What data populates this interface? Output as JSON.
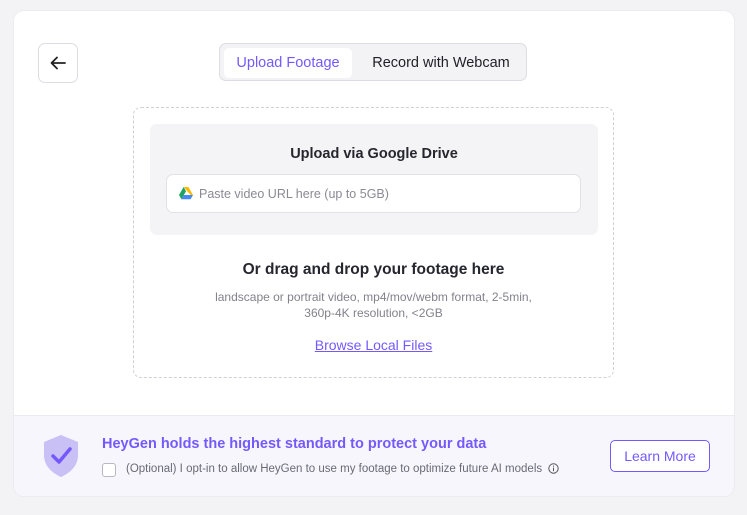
{
  "tabs": [
    {
      "label": "Upload Footage",
      "active": true
    },
    {
      "label": "Record with Webcam",
      "active": false
    }
  ],
  "back_button": {
    "icon": "arrow-left-icon"
  },
  "google_drive": {
    "title": "Upload via Google Drive",
    "placeholder": "Paste video URL here (up to 5GB)",
    "value": "",
    "icon": "google-drive-icon"
  },
  "drop_zone": {
    "title": "Or drag and drop your footage here",
    "description_line1": "landscape or portrait video, mp4/mov/webm format, 2-5min,",
    "description_line2": "360p-4K resolution, <2GB",
    "browse_label": "Browse Local Files"
  },
  "footer": {
    "title": "HeyGen holds the highest standard to protect your data",
    "opt_in_label": "(Optional) I opt-in to allow HeyGen to use my footage to optimize future AI models",
    "opt_in_checked": false,
    "learn_more_label": "Learn More",
    "shield_icon": "shield-check-icon",
    "info_icon": "info-icon"
  },
  "colors": {
    "accent": "#7559ff",
    "background": "#f3f3f5",
    "footer_bg": "#f7f6fd"
  }
}
